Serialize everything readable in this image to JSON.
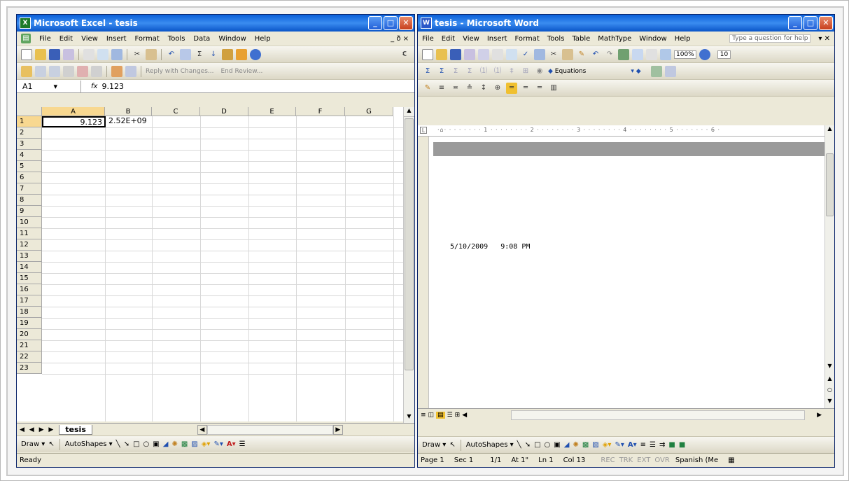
{
  "excel": {
    "title": "Microsoft Excel - tesis",
    "app_icon": "excel-icon",
    "menu": [
      "File",
      "Edit",
      "View",
      "Insert",
      "Format",
      "Tools",
      "Data",
      "Window",
      "Help"
    ],
    "menu_right": "_ ð ×",
    "review_text": "Reply with Changes...",
    "review_end": "End Review...",
    "name_box": "A1",
    "fx": "fx",
    "formula": "9.123",
    "columns": [
      "A",
      "B",
      "C",
      "D",
      "E",
      "F",
      "G"
    ],
    "rows": [
      "1",
      "2",
      "3",
      "4",
      "5",
      "6",
      "7",
      "8",
      "9",
      "10",
      "11",
      "12",
      "13",
      "14",
      "15",
      "16",
      "17",
      "18",
      "19",
      "20",
      "21",
      "22",
      "23"
    ],
    "cells": {
      "A1": "9.123",
      "B1": "2.52E+09"
    },
    "sheet_tab": "tesis",
    "draw": "Draw ▾",
    "autoshapes": "AutoShapes ▾",
    "status": "Ready"
  },
  "word": {
    "title": "tesis - Microsoft Word",
    "menu": [
      "File",
      "Edit",
      "View",
      "Insert",
      "Format",
      "Tools",
      "Table",
      "MathType",
      "Window",
      "Help"
    ],
    "help_box": "Type a question for help",
    "zoom": "100%",
    "font_size": "10",
    "equations": "Equations",
    "doc_date": "5/10/2009",
    "doc_time": "9:08 PM",
    "draw": "Draw ▾",
    "autoshapes": "AutoShapes ▾",
    "status": {
      "page": "Page 1",
      "sec": "Sec 1",
      "pages": "1/1",
      "at": "At 1\"",
      "ln": "Ln 1",
      "col": "Col 13",
      "rec": "REC",
      "trk": "TRK",
      "ext": "EXT",
      "ovr": "OVR",
      "lang": "Spanish (Me"
    }
  },
  "colors": {
    "title_blue": "#0a5fd8",
    "chrome": "#ece9d8",
    "close_red": "#c8401e"
  }
}
